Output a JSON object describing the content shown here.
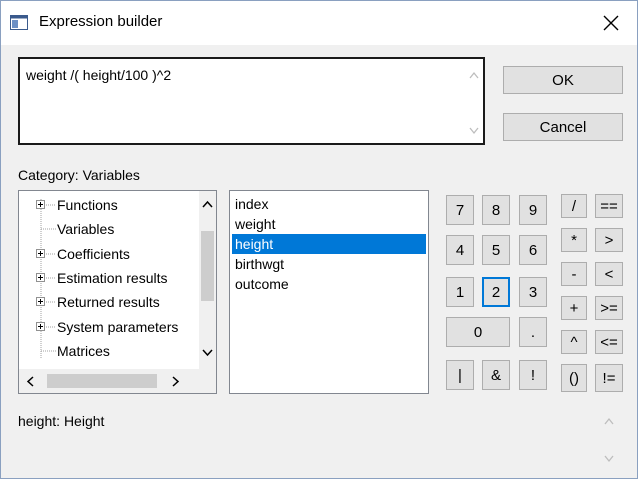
{
  "window": {
    "title": "Expression builder",
    "close_glyph": "✕"
  },
  "expression": {
    "value": "weight /( height/100 )^2"
  },
  "buttons": {
    "ok": "OK",
    "cancel": "Cancel"
  },
  "category": {
    "prefix": "Category:",
    "value": "Variables"
  },
  "tree": {
    "items": [
      {
        "label": "Functions",
        "expandable": true
      },
      {
        "label": "Variables",
        "expandable": false
      },
      {
        "label": "Coefficients",
        "expandable": true
      },
      {
        "label": "Estimation results",
        "expandable": true
      },
      {
        "label": "Returned results",
        "expandable": true
      },
      {
        "label": "System parameters",
        "expandable": true
      },
      {
        "label": "Matrices",
        "expandable": false
      }
    ]
  },
  "variables": {
    "items": [
      "index",
      "weight",
      "height",
      "birthwgt",
      "outcome"
    ],
    "selected": "height"
  },
  "keypad": {
    "digits": [
      "7",
      "8",
      "9",
      "4",
      "5",
      "6",
      "1",
      "2",
      "3",
      "0",
      "."
    ],
    "logic": [
      "|",
      "&",
      "!"
    ],
    "operators": [
      "/",
      "*",
      "-",
      "+",
      "^",
      "()"
    ],
    "comparisons": [
      "==",
      ">",
      "<",
      ">=",
      "<=",
      "!="
    ]
  },
  "description": {
    "name": "height:",
    "label": "Height"
  },
  "colors": {
    "selection": "#0078d7",
    "focus_border": "#0078d7"
  }
}
